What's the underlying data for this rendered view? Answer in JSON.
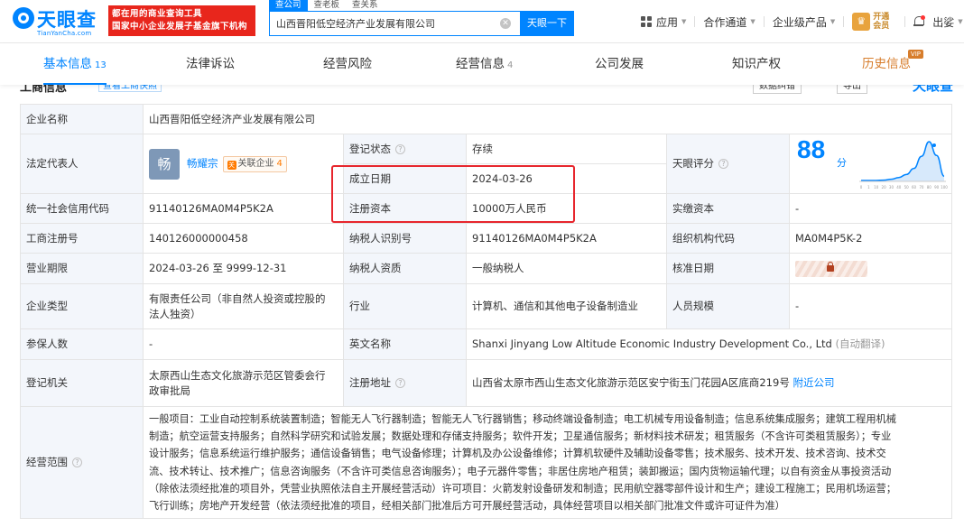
{
  "header": {
    "logo_text": "天眼查",
    "logo_domain": "TianYanCha.com",
    "slogan_line1": "都在用的商业查询工具",
    "slogan_line2": "国家中小企业发展子基金旗下机构",
    "search_tabs": [
      "查公司",
      "查老板",
      "查关系"
    ],
    "search_value": "山西晋阳低空经济产业发展有限公司",
    "search_button": "天眼一下",
    "nav": {
      "apps": "应用",
      "cooperation": "合作通道",
      "enterprise": "企业级产品",
      "vip_line1": "开通",
      "vip_line2": "会员",
      "user": "出娑"
    }
  },
  "tabs": [
    {
      "label": "基本信息",
      "count": "13"
    },
    {
      "label": "法律诉讼",
      "count": ""
    },
    {
      "label": "经营风险",
      "count": ""
    },
    {
      "label": "经营信息",
      "count": "4"
    },
    {
      "label": "公司发展",
      "count": ""
    },
    {
      "label": "知识产权",
      "count": ""
    },
    {
      "label": "历史信息",
      "count": "",
      "tag": "VIP"
    }
  ],
  "section": {
    "title": "工商信息",
    "mini_tag": "查看工商快照",
    "btn_correct": "数据纠错",
    "btn_export": "导出",
    "logo": "天眼查"
  },
  "info": {
    "company_name_label": "企业名称",
    "company_name": "山西晋阳低空经济产业发展有限公司",
    "legal_rep_label": "法定代表人",
    "legal_rep_avatar": "畅",
    "legal_rep_name": "畅耀宗",
    "related_label": "关联企业",
    "related_count": "4",
    "reg_status_label": "登记状态",
    "reg_status": "存续",
    "established_label": "成立日期",
    "established": "2024-03-26",
    "score_label": "天眼评分",
    "score": "88",
    "score_unit": "分",
    "credit_code_label": "统一社会信用代码",
    "credit_code": "91140126MA0M4P5K2A",
    "reg_capital_label": "注册资本",
    "reg_capital": "10000万人民币",
    "paid_capital_label": "实缴资本",
    "paid_capital": "-",
    "reg_no_label": "工商注册号",
    "reg_no": "140126000000458",
    "tax_id_label": "纳税人识别号",
    "tax_id": "91140126MA0M4P5K2A",
    "org_code_label": "组织机构代码",
    "org_code": "MA0M4P5K-2",
    "term_label": "营业期限",
    "term": "2024-03-26 至 9999-12-31",
    "taxpayer_label": "纳税人资质",
    "taxpayer": "一般纳税人",
    "approval_date_label": "核准日期",
    "type_label": "企业类型",
    "type_line1": "有限责任公司（非自然人投资或控股的",
    "type_line2": "法人独资）",
    "industry_label": "行业",
    "industry": "计算机、通信和其他电子设备制造业",
    "staff_label": "人员规模",
    "staff": "-",
    "insured_label": "参保人数",
    "insured": "-",
    "en_name_label": "英文名称",
    "en_name": "Shanxi Jinyang Low Altitude Economic Industry Development Co., Ltd",
    "auto_translate": "(自动翻译)",
    "authority_label": "登记机关",
    "authority_line1": "太原西山生态文化旅游示范区管委会行",
    "authority_line2": "政审批局",
    "address_label": "注册地址",
    "address": "山西省太原市西山生态文化旅游示范区安宁街玉门花园A区底商219号",
    "nearby": "附近公司",
    "scope_label": "经营范围",
    "scope_lines": [
      "一般项目：工业自动控制系统装置制造；智能无人飞行器制造；智能无人飞行器销售；移动终端设备制造；电工机械专用设备制造；信息系统集成服务；建筑工程用机械",
      "制造；航空运营支持服务；自然科学研究和试验发展；数据处理和存储支持服务；软件开发；卫星通信服务；新材料技术研发；租赁服务（不含许可类租赁服务）；专业",
      "设计服务；信息系统运行维护服务；通信设备销售；电气设备修理；计算机及办公设备维修；计算机软硬件及辅助设备零售；技术服务、技术开发、技术咨询、技术交",
      "流、技术转让、技术推广；信息咨询服务（不含许可类信息咨询服务）；电子元器件零售；非居住房地产租赁；装卸搬运；国内货物运输代理；以自有资金从事投资活动",
      "（除依法须经批准的项目外，凭营业执照依法自主开展经营活动）许可项目：火箭发射设备研发和制造；民用航空器零部件设计和生产；建设工程施工；民用机场运营；",
      "飞行训练；房地产开发经营（依法须经批准的项目，经相关部门批准后方可开展经营活动，具体经营项目以相关部门批准文件或许可证件为准）"
    ]
  },
  "chart_data": {
    "type": "area",
    "categories": [
      "0",
      "1",
      "10",
      "20",
      "30",
      "40",
      "50",
      "60",
      "70",
      "80",
      "90",
      "100"
    ],
    "values": [
      2,
      2,
      2,
      3,
      5,
      9,
      16,
      30,
      58,
      92,
      60,
      12
    ],
    "highlight_value": 88,
    "colors": {
      "fill": "#d7e9fb",
      "stroke": "#0084ff",
      "axis": "#cccccc"
    }
  }
}
